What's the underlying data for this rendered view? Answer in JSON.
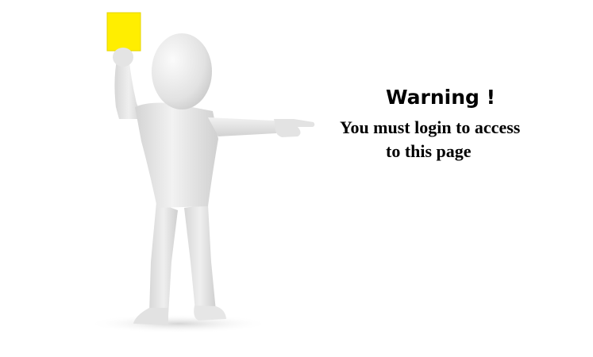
{
  "warning": {
    "title": "Warning !",
    "message_line_1": "You must login to access",
    "message_line_2": "to this page"
  },
  "illustration": {
    "icon": "person-holding-yellow-card-icon",
    "card_color": "#ffee00",
    "figure_color": "#e6e6e6"
  }
}
